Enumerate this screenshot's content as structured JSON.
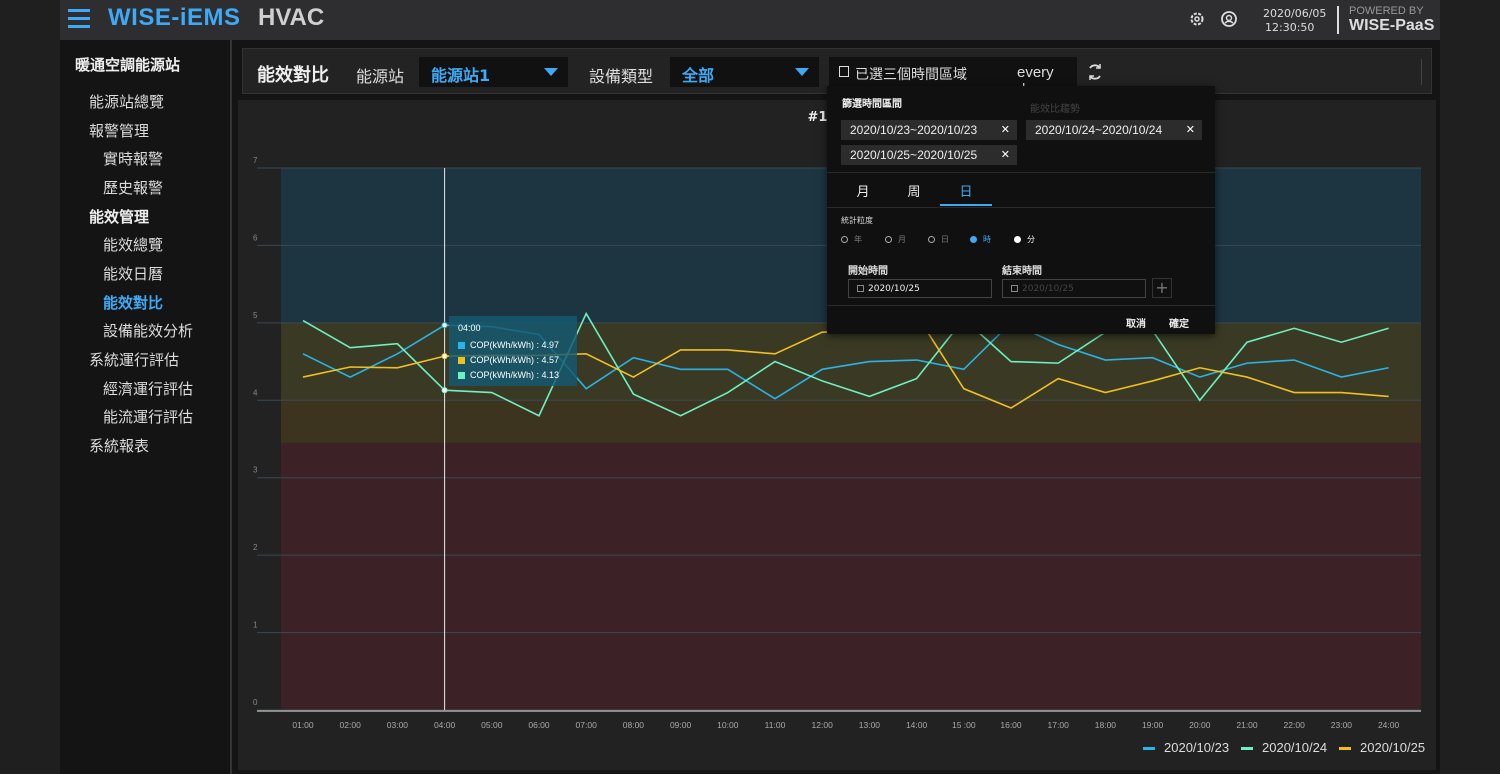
{
  "header": {
    "brand": "WISE-iEMS",
    "product": "HVAC",
    "date": "2020/06/05",
    "time": "12:30:50",
    "powered_top": "POWERED BY",
    "powered_brand": "WISE-PaaS"
  },
  "sidebar": {
    "title": "暖通空調能源站",
    "items": [
      {
        "label": "能源站總覽"
      },
      {
        "label": "報警管理"
      },
      {
        "label": "實時報警"
      },
      {
        "label": "歷史報警"
      },
      {
        "label": "能效管理"
      },
      {
        "label": "能效總覽"
      },
      {
        "label": "能效日曆"
      },
      {
        "label": "能效對比"
      },
      {
        "label": "設備能效分析"
      },
      {
        "label": "系統運行評估"
      },
      {
        "label": "經濟運行評估"
      },
      {
        "label": "能流運行評估"
      },
      {
        "label": "系統報表"
      }
    ]
  },
  "filter": {
    "page_title": "能效對比",
    "station_label": "能源站",
    "station_value": "能源站1",
    "type_label": "設備類型",
    "type_value": "全部",
    "range_text": "已選三個時間區域",
    "range_mode": "every day"
  },
  "popup": {
    "heading": "篩選時間區間",
    "heading_faded": "能效比趨勢",
    "chips": [
      "2020/10/23~2020/10/23",
      "2020/10/24~2020/10/24",
      "2020/10/25~2020/10/25"
    ],
    "tabs": [
      "月",
      "周",
      "日"
    ],
    "granularity_label": "統計粒度",
    "radios": [
      "年",
      "月",
      "日",
      "時",
      "分"
    ],
    "start_label": "開始時間",
    "end_label": "結束時間",
    "start_value": "2020/10/25",
    "end_placeholder": "2020/10/25",
    "cancel": "取消",
    "confirm": "確定"
  },
  "tooltip": {
    "time": "04:00",
    "rows": [
      "COP(kWh/kWh) : 4.97",
      "COP(kWh/kWh) : 4.57",
      "COP(kWh/kWh) : 4.13"
    ]
  },
  "colors": {
    "accent": "#3fa9f5",
    "s1": "#2ab3e6",
    "s2": "#6ff0c0",
    "s3": "#f0c020",
    "band_high": "#1d3540",
    "band_mid": "#3a3a24",
    "band_orange": "#3d3420",
    "band_low": "#3c2226"
  },
  "chart_data": {
    "type": "line",
    "title": "#1能源站",
    "x": [
      "01:00",
      "02:00",
      "03:00",
      "04:00",
      "05:00",
      "06:00",
      "07:00",
      "08:00",
      "09:00",
      "10:00",
      "11:00",
      "12:00",
      "13:00",
      "14:00",
      "15 :00",
      "16:00",
      "17:00",
      "18:00",
      "19:00",
      "20:00",
      "21:00",
      "22:00",
      "23:00",
      "24:00"
    ],
    "ylim": [
      0,
      7
    ],
    "yticks": [
      0,
      1,
      2,
      3,
      4,
      5,
      6,
      7
    ],
    "bands": [
      {
        "from": 5,
        "to": 7,
        "color": "band_high"
      },
      {
        "from": 4,
        "to": 5,
        "color": "band_mid"
      },
      {
        "from": 3.45,
        "to": 4,
        "color": "band_orange"
      },
      {
        "from": 0,
        "to": 3.45,
        "color": "band_low"
      }
    ],
    "series": [
      {
        "name": "2020/10/23",
        "color": "s1",
        "values": [
          4.6,
          4.3,
          4.6,
          4.97,
          4.95,
          4.85,
          4.15,
          4.55,
          4.4,
          4.4,
          4.02,
          4.4,
          4.5,
          4.52,
          4.4,
          5.0,
          4.72,
          4.52,
          4.55,
          4.3,
          4.48,
          4.52,
          4.3,
          4.42
        ]
      },
      {
        "name": "2020/10/24",
        "color": "s2",
        "values": [
          5.03,
          4.68,
          4.73,
          4.13,
          4.1,
          3.8,
          5.12,
          4.08,
          3.8,
          4.1,
          4.5,
          4.25,
          4.05,
          4.28,
          5.05,
          4.5,
          4.48,
          4.88,
          4.9,
          4.0,
          4.75,
          4.93,
          4.75,
          4.93
        ]
      },
      {
        "name": "2020/10/25",
        "color": "s3",
        "values": [
          4.3,
          4.43,
          4.42,
          4.57,
          4.58,
          4.58,
          4.6,
          4.3,
          4.65,
          4.65,
          4.6,
          4.88,
          4.9,
          5.1,
          4.15,
          3.9,
          4.28,
          4.1,
          4.25,
          4.42,
          4.3,
          4.1,
          4.1,
          4.05
        ]
      }
    ],
    "legend": "bottom-right",
    "cursor_index": 3
  }
}
